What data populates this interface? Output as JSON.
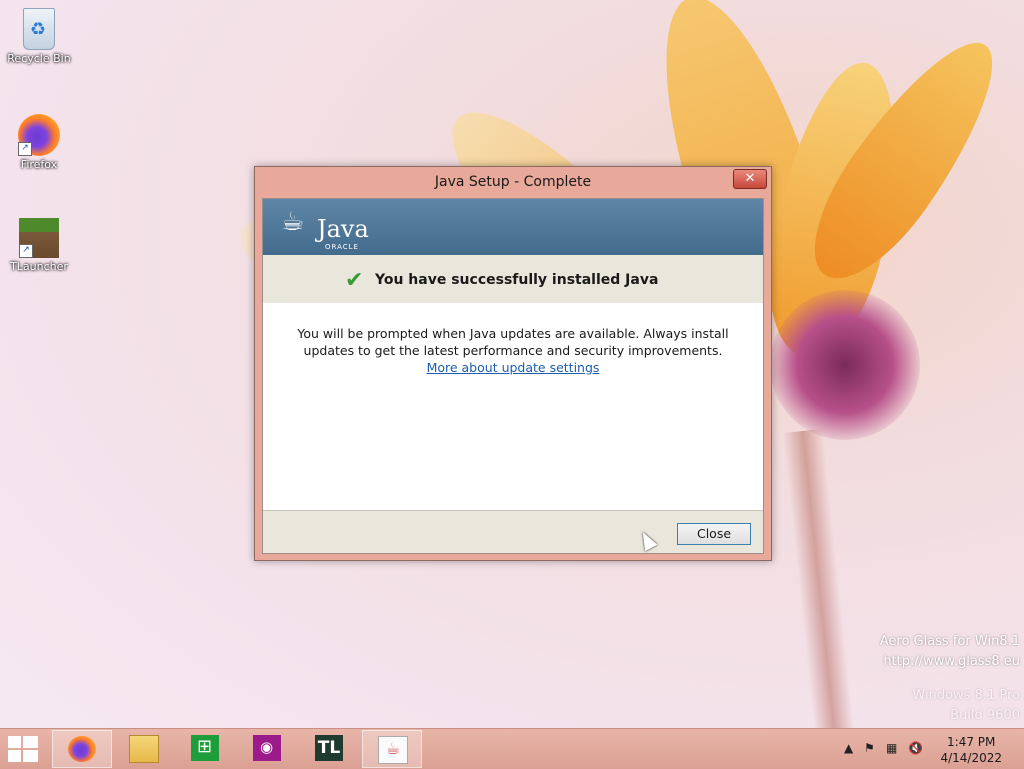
{
  "desktop": {
    "icons": [
      {
        "label": "Recycle Bin"
      },
      {
        "label": "Firefox"
      },
      {
        "label": "TLauncher"
      }
    ]
  },
  "dialog": {
    "title": "Java Setup - Complete",
    "close_glyph": "✕",
    "logo_text": "Java",
    "logo_sub": "ORACLE",
    "success_message": "You have successfully installed Java",
    "body_line1": "You will be prompted when Java updates are available. Always install",
    "body_line2": "updates to get the latest performance and security improvements.",
    "link_text": "More about update settings",
    "close_button": "Close"
  },
  "watermark": {
    "line1": "Aero Glass for Win8.1",
    "line2": "http://www.glass8.eu",
    "line3": "Windows 8.1 Pro",
    "line4": "Build 9600"
  },
  "taskbar": {
    "pinned": [
      {
        "name": "firefox",
        "icon": "firefox-icon"
      },
      {
        "name": "file-explorer",
        "icon": "folder-icon"
      },
      {
        "name": "store",
        "icon": "store-icon"
      },
      {
        "name": "camera",
        "icon": "camera-icon"
      },
      {
        "name": "tlauncher",
        "icon": "tl-icon",
        "label": "TL"
      },
      {
        "name": "java-setup",
        "icon": "java-cup-icon"
      }
    ],
    "clock_time": "1:47 PM",
    "clock_date": "4/14/2022"
  },
  "colors": {
    "banner": "#4f7798",
    "link": "#1c5eae",
    "check": "#3a9a3a",
    "titlebar_close": "#c7463a"
  }
}
